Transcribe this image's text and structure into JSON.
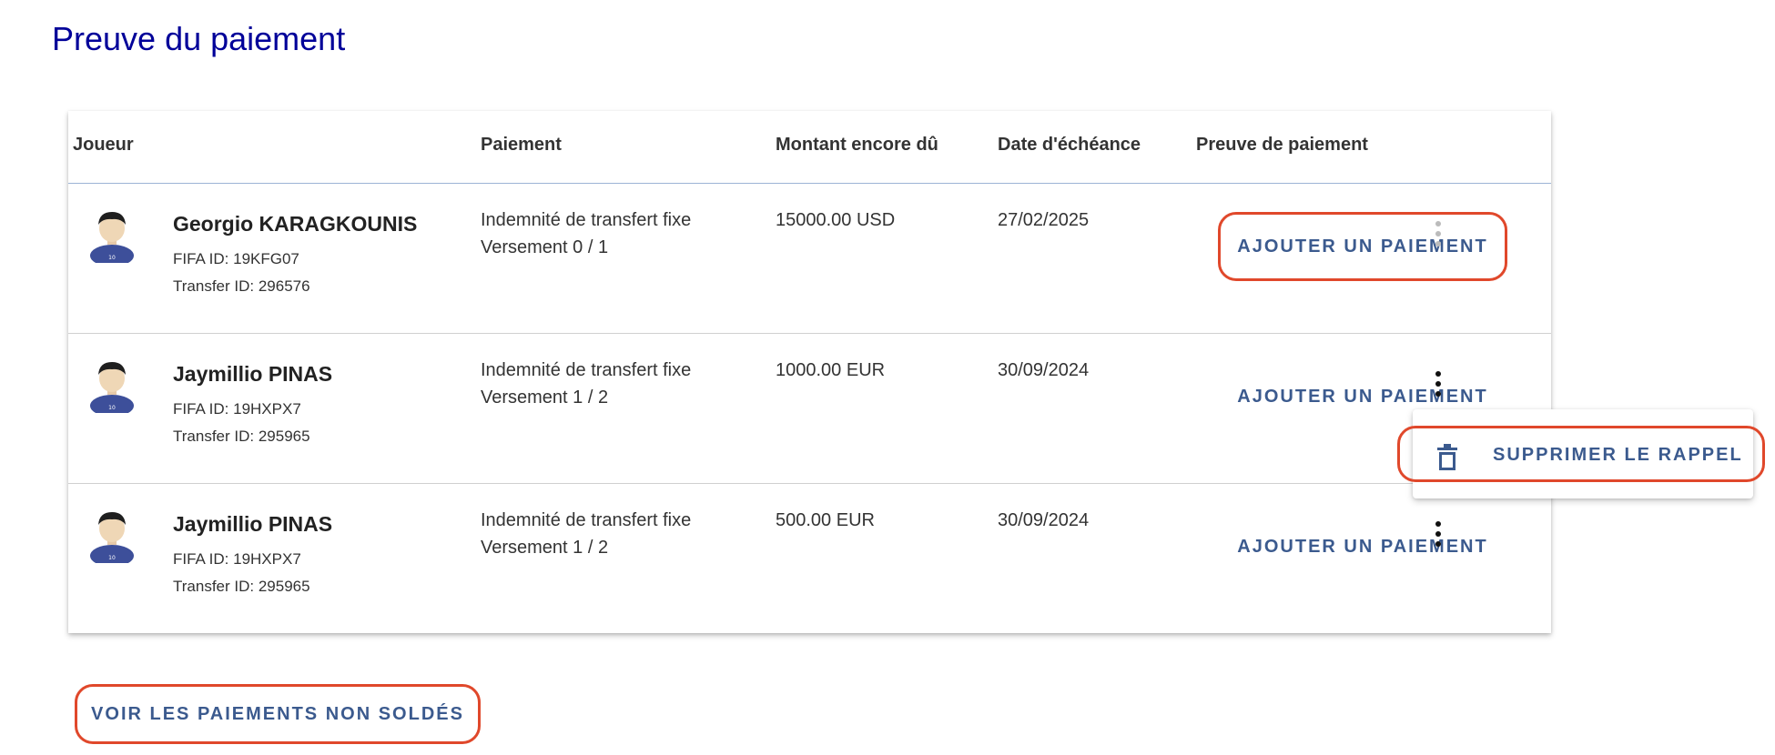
{
  "page": {
    "title": "Preuve du paiement"
  },
  "table": {
    "headers": {
      "player": "Joueur",
      "payment": "Paiement",
      "amount_due": "Montant encore dû",
      "due_date": "Date d'échéance",
      "proof": "Preuve de paiement"
    },
    "rows": [
      {
        "name": "Georgio KARAGKOUNIS",
        "fifa_id": "FIFA ID: 19KFG07",
        "transfer_id": "Transfer ID: 296576",
        "payment_type": "Indemnité de transfert fixe",
        "installment": "Versement 0 / 1",
        "amount": "15000.00 USD",
        "due_date": "27/02/2025",
        "action_label": "AJOUTER UN PAIEMENT"
      },
      {
        "name": "Jaymillio PINAS",
        "fifa_id": "FIFA ID: 19HXPX7",
        "transfer_id": "Transfer ID: 295965",
        "payment_type": "Indemnité de transfert fixe",
        "installment": "Versement 1 / 2",
        "amount": "1000.00 EUR",
        "due_date": "30/09/2024",
        "action_label": "AJOUTER UN PAIEMENT"
      },
      {
        "name": "Jaymillio PINAS",
        "fifa_id": "FIFA ID: 19HXPX7",
        "transfer_id": "Transfer ID: 295965",
        "payment_type": "Indemnité de transfert fixe",
        "installment": "Versement 1 / 2",
        "amount": "500.00 EUR",
        "due_date": "30/09/2024",
        "action_label": "AJOUTER UN PAIEMENT"
      }
    ]
  },
  "context_menu": {
    "delete_reminder": "SUPPRIMER LE RAPPEL",
    "icon": "trash-icon"
  },
  "footer": {
    "view_unpaid": "VOIR LES PAIEMENTS NON SOLDÉS"
  },
  "colors": {
    "title": "#000099",
    "accent": "#3b5a8e",
    "highlight": "#e0482b"
  }
}
